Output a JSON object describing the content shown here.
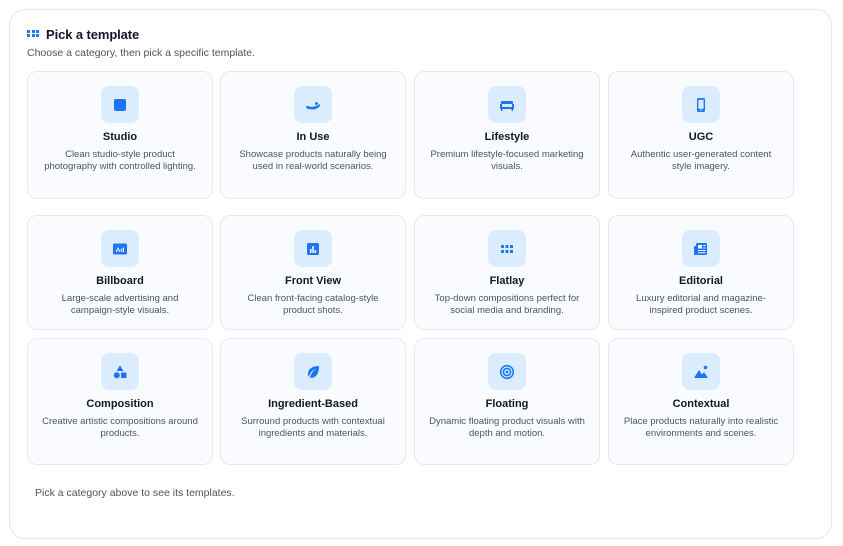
{
  "header": {
    "title": "Pick a template",
    "subtitle": "Choose a category, then pick a specific template."
  },
  "categories": [
    {
      "title": "Studio",
      "description": "Clean studio-style product photography with controlled lighting.",
      "icon": "square-icon"
    },
    {
      "title": "In Use",
      "description": "Showcase products naturally being used in real-world scenarios.",
      "icon": "hand-icon"
    },
    {
      "title": "Lifestyle",
      "description": "Premium lifestyle-focused marketing visuals.",
      "icon": "sofa-icon"
    },
    {
      "title": "UGC",
      "description": "Authentic user-generated content style imagery.",
      "icon": "smartphone-icon"
    },
    {
      "title": "Billboard",
      "description": "Large-scale advertising and campaign-style visuals.",
      "icon": "ad-icon"
    },
    {
      "title": "Front View",
      "description": "Clean front-facing catalog-style product shots.",
      "icon": "bar-chart-icon"
    },
    {
      "title": "Flatlay",
      "description": "Top-down compositions perfect for social media and branding.",
      "icon": "grid-dots-icon"
    },
    {
      "title": "Editorial",
      "description": "Luxury editorial and magazine-inspired product scenes.",
      "icon": "newspaper-icon"
    },
    {
      "title": "Composition",
      "description": "Creative artistic compositions around products.",
      "icon": "shapes-icon"
    },
    {
      "title": "Ingredient-Based",
      "description": "Surround products with contextual ingredients and materials.",
      "icon": "leaf-icon"
    },
    {
      "title": "Floating",
      "description": "Dynamic floating product visuals with depth and motion.",
      "icon": "target-icon"
    },
    {
      "title": "Contextual",
      "description": "Place products naturally into realistic environments and scenes.",
      "icon": "landscape-icon"
    }
  ],
  "footer": {
    "note": "Pick a category above to see its templates."
  },
  "colors": {
    "accent": "#1d74f5",
    "icon_background": "#dcecff",
    "card_background": "#f9fbfe",
    "card_border": "#e5e9f0"
  }
}
